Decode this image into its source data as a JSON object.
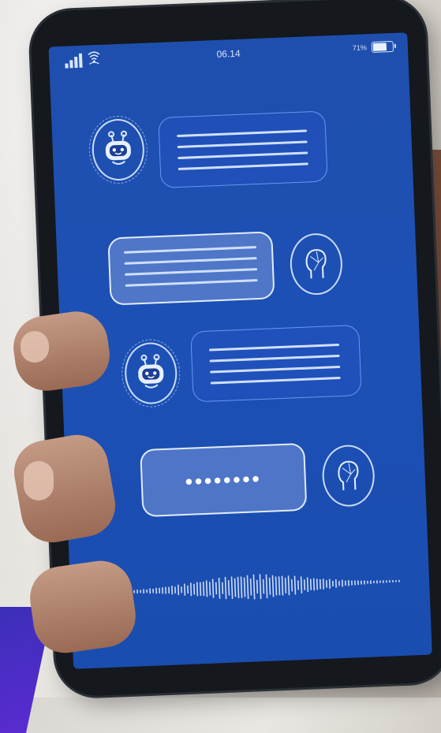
{
  "status_bar": {
    "time": "06.14",
    "battery_percent": "71%",
    "battery_level": 0.71,
    "signal_icon": "signal-bars-icon",
    "wifi_icon": "wifi-icon"
  },
  "chat": {
    "messages": [
      {
        "sender": "bot",
        "avatar_icon": "robot-icon"
      },
      {
        "sender": "user",
        "avatar_icon": "human-head-icon"
      },
      {
        "sender": "bot",
        "avatar_icon": "robot-icon"
      },
      {
        "sender": "user",
        "avatar_icon": "human-head-icon",
        "typing_indicator": "••••••••"
      }
    ],
    "voice_waveform_icon": "sound-wave-icon"
  },
  "colors": {
    "screen_blue": "#1d50b5",
    "bubble_outline": "#cfe0ff",
    "accent_purple": "#4a2dc6"
  }
}
